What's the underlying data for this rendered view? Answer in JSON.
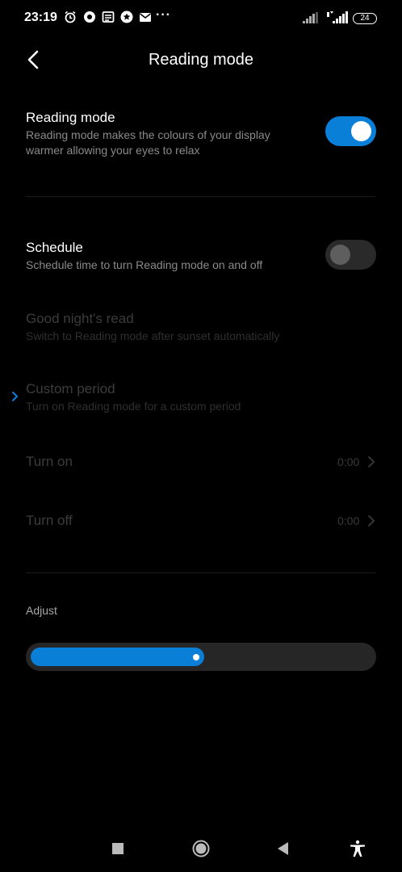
{
  "status_bar": {
    "time": "23:19",
    "battery": "24",
    "more": "···",
    "icons": [
      "alarm-icon",
      "media-icon",
      "news-icon",
      "star-app-icon",
      "mail-icon"
    ],
    "signal_icons": [
      "signal-bars-icon",
      "volte-signal-icon"
    ]
  },
  "header": {
    "title": "Reading mode",
    "back_icon": "back-arrow-icon"
  },
  "reading_mode": {
    "title": "Reading mode",
    "description": "Reading mode makes the colours of your display warmer allowing your eyes to relax",
    "enabled": true
  },
  "schedule": {
    "title": "Schedule",
    "description": "Schedule time to turn Reading mode on and off",
    "enabled": false
  },
  "good_nights_read": {
    "title": "Good night's read",
    "description": "Switch to Reading mode after sunset automatically"
  },
  "custom_period": {
    "title": "Custom period",
    "description": "Turn on Reading mode for a custom period",
    "selected": true
  },
  "turn_on": {
    "label": "Turn on",
    "value": "0:00"
  },
  "turn_off": {
    "label": "Turn off",
    "value": "0:00"
  },
  "adjust": {
    "label": "Adjust",
    "level": 0.5
  },
  "colors": {
    "accent": "#0a7fd8",
    "background": "#000000",
    "disabled_text": "#3c3c3c"
  },
  "nav_bar": [
    "recents-square-icon",
    "home-circle-icon",
    "back-triangle-icon",
    "accessibility-icon"
  ]
}
